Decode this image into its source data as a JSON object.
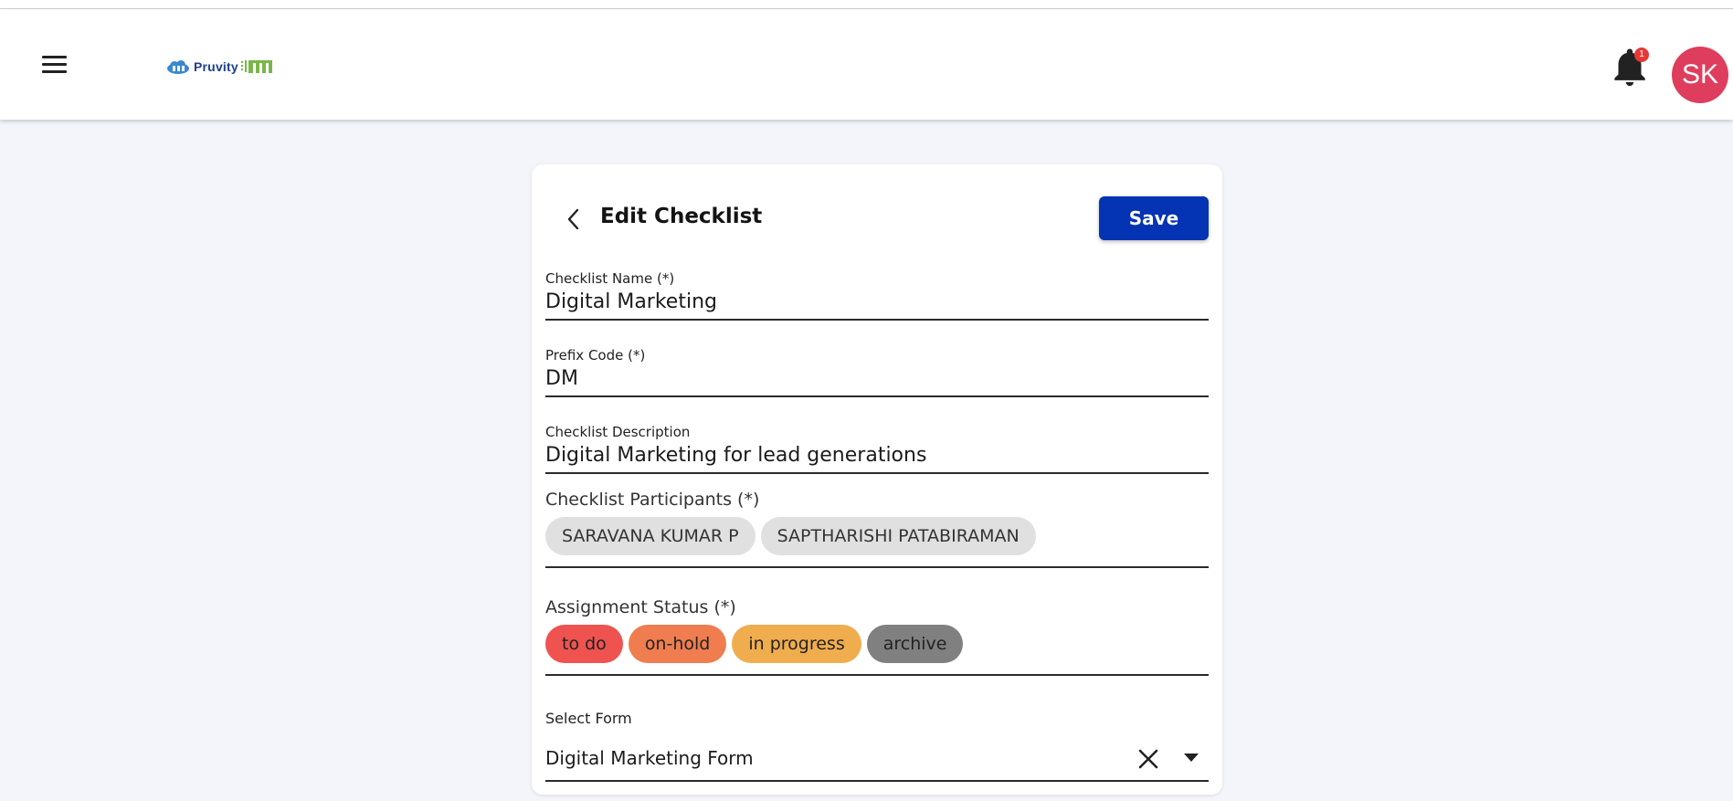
{
  "header": {
    "brand": "Pruvity",
    "notifications_count": "1",
    "avatar_initials": "SK"
  },
  "card": {
    "title": "Edit Checklist",
    "save_label": "Save",
    "fields": {
      "name": {
        "label": "Checklist Name (*)",
        "value": "Digital Marketing"
      },
      "prefix": {
        "label": "Prefix Code (*)",
        "value": "DM"
      },
      "description": {
        "label": "Checklist Description",
        "value": "Digital Marketing for lead generations"
      }
    },
    "participants": {
      "label": "Checklist Participants (*)",
      "items": [
        "SARAVANA KUMAR P",
        "SAPTHARISHI PATABIRAMAN"
      ]
    },
    "assignment_status": {
      "label": "Assignment Status (*)",
      "items": [
        {
          "label": "to do",
          "color": "#ef5350"
        },
        {
          "label": "on-hold",
          "color": "#ef7d4f"
        },
        {
          "label": "in progress",
          "color": "#f0ad4e"
        },
        {
          "label": "archive",
          "color": "#808080"
        }
      ]
    },
    "select_form": {
      "label": "Select Form",
      "value": "Digital Marketing Form"
    }
  },
  "colors": {
    "primary": "#0433b3",
    "avatar": "#df3d5d",
    "badge": "#e53935",
    "background": "#f4f5fa"
  },
  "icons": [
    "menu-icon",
    "cloud-logo-icon",
    "bell-icon",
    "chevron-left-icon",
    "close-icon",
    "caret-down-icon"
  ]
}
